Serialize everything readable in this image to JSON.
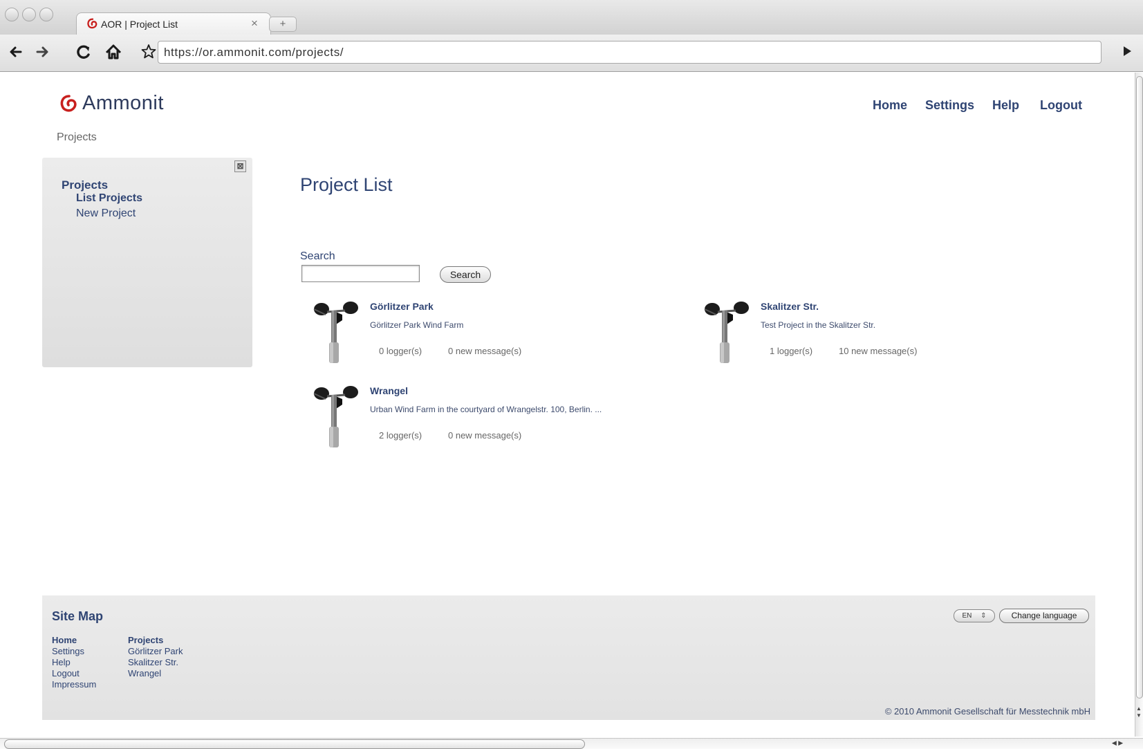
{
  "browser": {
    "tab_title": "AOR | Project List",
    "tab_close": "×",
    "new_tab": "+",
    "url": "https://or.ammonit.com/projects/"
  },
  "header": {
    "logo_text": "Ammonit",
    "nav": [
      "Home",
      "Settings",
      "Help",
      "Logout"
    ]
  },
  "breadcrumb": "Projects",
  "sidebar": {
    "close_icon": "⊠",
    "heading": "Projects",
    "items": [
      {
        "label": "List Projects",
        "active": true
      },
      {
        "label": "New Project",
        "active": false
      }
    ]
  },
  "main": {
    "title": "Project List",
    "search_label": "Search",
    "search_value": "",
    "search_button": "Search",
    "projects": [
      {
        "name": "Görlitzer Park",
        "description": "Görlitzer Park Wind Farm",
        "loggers": "0 logger(s)",
        "messages": "0 new message(s)"
      },
      {
        "name": "Skalitzer Str.",
        "description": "Test Project in the Skalitzer Str.",
        "loggers": "1 logger(s)",
        "messages": "10 new message(s)"
      },
      {
        "name": "Wrangel",
        "description": "Urban Wind Farm in the courtyard of Wrangelstr. 100, Berlin. ...",
        "loggers": "2 logger(s)",
        "messages": "0 new message(s)"
      }
    ]
  },
  "footer": {
    "site_map_title": "Site Map",
    "col1": [
      "Home",
      "Settings",
      "Help",
      "Logout",
      "Impressum"
    ],
    "col2": [
      "Projects",
      "Görlitzer Park",
      "Skalitzer Str.",
      "Wrangel"
    ],
    "language_value": "EN",
    "change_language": "Change language",
    "copyright": "© 2010 Ammonit Gesellschaft für Messtechnik mbH"
  },
  "colors": {
    "brand_red": "#c8201e",
    "nav_blue": "#2f4473"
  }
}
